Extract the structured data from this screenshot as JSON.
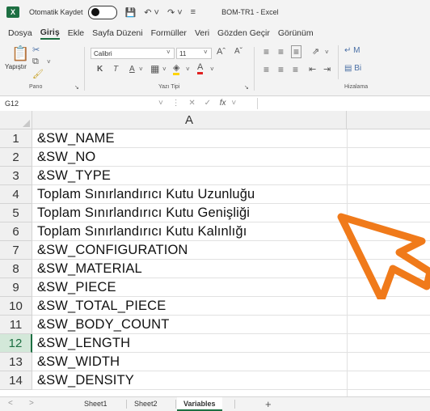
{
  "titlebar": {
    "autosave_label": "Otomatik Kaydet",
    "document_title": "BOM-TR1  -  Excel"
  },
  "menu": {
    "items": [
      "Dosya",
      "Giriş",
      "Ekle",
      "Sayfa Düzeni",
      "Formüller",
      "Veri",
      "Gözden Geçir",
      "Görünüm"
    ],
    "active": "Giriş"
  },
  "ribbon": {
    "paste_label": "Yapıştır",
    "font_name": "Calibri",
    "font_size": "11",
    "group_labels": {
      "clipboard": "Pano",
      "font": "Yazı Tipi",
      "alignment": "Hizalama"
    }
  },
  "formula_bar": {
    "name_box": "G12",
    "fx_label": "fx",
    "value": ""
  },
  "sheet": {
    "column_header": "A",
    "selected_row": 12,
    "rows": [
      {
        "num": "1",
        "value": "&SW_NAME"
      },
      {
        "num": "2",
        "value": "&SW_NO"
      },
      {
        "num": "3",
        "value": "&SW_TYPE"
      },
      {
        "num": "4",
        "value": "Toplam Sınırlandırıcı Kutu Uzunluğu"
      },
      {
        "num": "5",
        "value": "Toplam Sınırlandırıcı Kutu Genişliği"
      },
      {
        "num": "6",
        "value": "Toplam Sınırlandırıcı Kutu Kalınlığı"
      },
      {
        "num": "7",
        "value": "&SW_CONFIGURATION"
      },
      {
        "num": "8",
        "value": "&SW_MATERIAL"
      },
      {
        "num": "9",
        "value": "&SW_PIECE"
      },
      {
        "num": "10",
        "value": "&SW_TOTAL_PIECE"
      },
      {
        "num": "11",
        "value": "&SW_BODY_COUNT"
      },
      {
        "num": "12",
        "value": "&SW_LENGTH"
      },
      {
        "num": "13",
        "value": "&SW_WIDTH"
      },
      {
        "num": "14",
        "value": "&SW_DENSITY"
      }
    ]
  },
  "tabs": {
    "sheets": [
      "Sheet1",
      "Sheet2",
      "Variables"
    ],
    "active": "Variables",
    "add_label": "+"
  },
  "colors": {
    "excel_green": "#1d6f42",
    "cursor_orange": "#f07a1a",
    "chrome_bg": "#f3f3f3"
  },
  "icons": [
    "excel-logo-icon",
    "save-icon",
    "undo-icon",
    "redo-icon",
    "paste-icon",
    "cut-icon",
    "copy-icon",
    "format-painter-icon",
    "bold-icon",
    "italic-icon",
    "underline-icon",
    "border-icon",
    "fill-color-icon",
    "font-color-icon",
    "cursor-arrow-icon"
  ]
}
